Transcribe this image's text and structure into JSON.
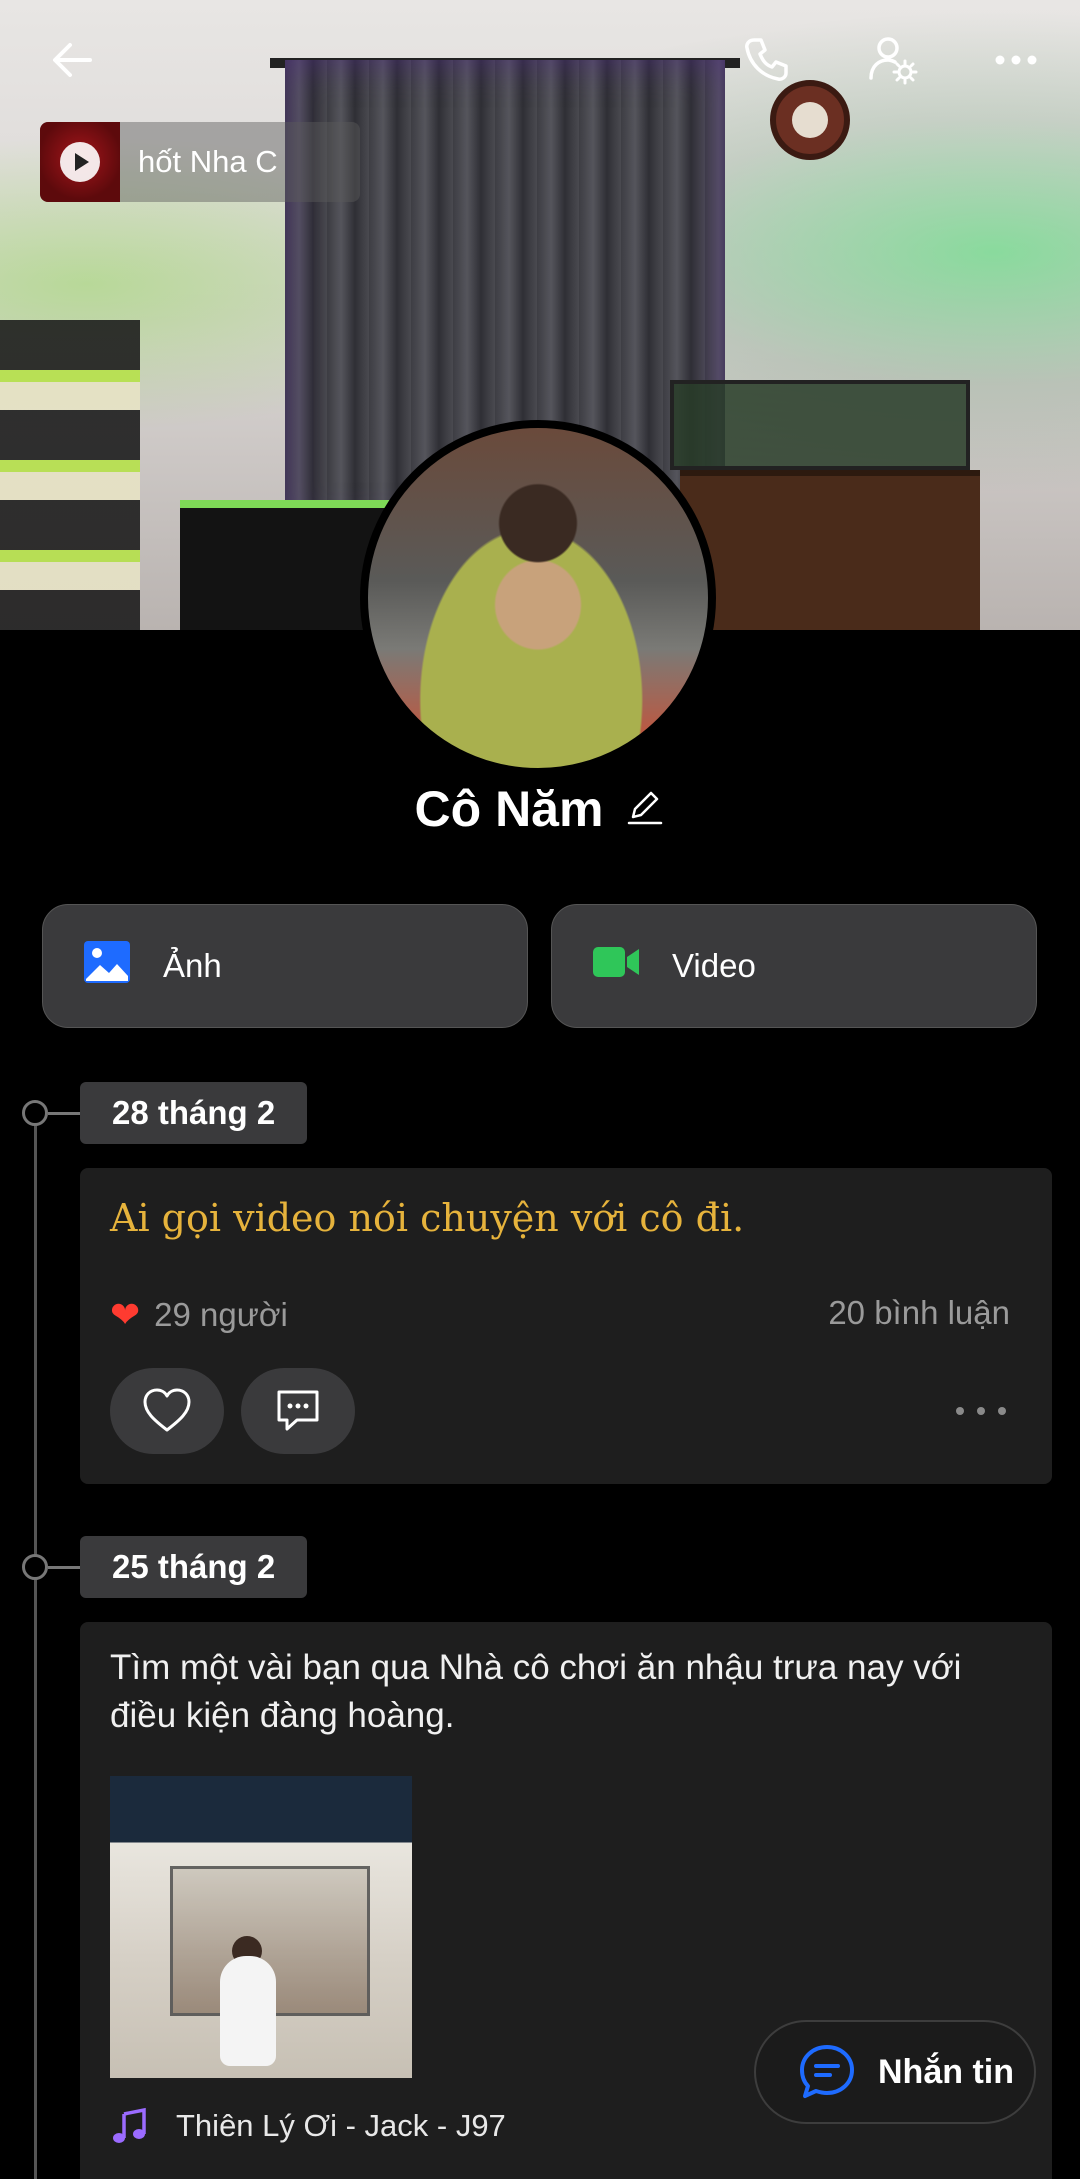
{
  "profile": {
    "name": "Cô Năm"
  },
  "cover": {
    "music_chip_text": "hốt Nha        C"
  },
  "header": {
    "back_icon": "back-arrow-icon",
    "call_icon": "phone-icon",
    "settings_icon": "user-settings-icon",
    "more_icon": "more-icon"
  },
  "media_buttons": [
    {
      "label": "Ảnh",
      "icon": "image-icon",
      "color": "#1e6bff"
    },
    {
      "label": "Video",
      "icon": "video-icon",
      "color": "#2fc659"
    }
  ],
  "posts": [
    {
      "date": "28 tháng 2",
      "text": "Ai gọi video nói chuyện với cô đi.",
      "likes": "29 người",
      "comments": "20 bình luận"
    },
    {
      "date": "25 tháng 2",
      "text": "Tìm một vài bạn qua Nhà cô chơi ăn nhậu trưa nay với điều kiện đàng hoàng.",
      "song": "Thiên Lý Ơi - Jack - J97"
    }
  ],
  "fab": {
    "label": "Nhắn tin"
  },
  "colors": {
    "accent_blue": "#1e6bff",
    "quote_yellow": "#e6b33c",
    "heart_red": "#ff3b30",
    "music_purple": "#9b6bff"
  }
}
